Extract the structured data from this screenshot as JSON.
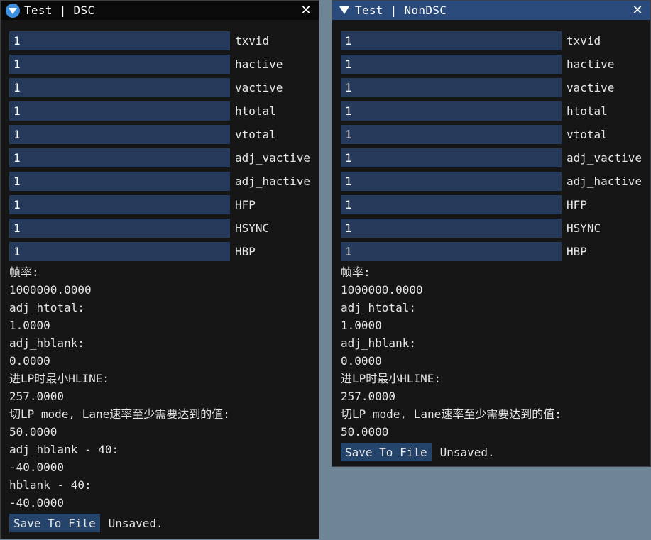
{
  "dsc": {
    "title": "Test | DSC",
    "close": "✕",
    "fields": [
      {
        "value": "1",
        "label": "txvid"
      },
      {
        "value": "1",
        "label": "hactive"
      },
      {
        "value": "1",
        "label": "vactive"
      },
      {
        "value": "1",
        "label": "htotal"
      },
      {
        "value": "1",
        "label": "vtotal"
      },
      {
        "value": "1",
        "label": "adj_vactive"
      },
      {
        "value": "1",
        "label": "adj_hactive"
      },
      {
        "value": "1",
        "label": "HFP"
      },
      {
        "value": "1",
        "label": "HSYNC"
      },
      {
        "value": "1",
        "label": "HBP"
      }
    ],
    "outputs": [
      "帧率:",
      "1000000.0000",
      "adj_htotal:",
      "1.0000",
      "adj_hblank:",
      "0.0000",
      "进LP时最小HLINE:",
      "257.0000",
      "切LP mode, Lane速率至少需要达到的值:",
      "50.0000",
      "adj_hblank - 40:",
      "-40.0000",
      "hblank - 40:",
      "-40.0000"
    ],
    "save_label": "Save To File",
    "status": "Unsaved."
  },
  "nondsc": {
    "title": "Test | NonDSC",
    "close": "✕",
    "fields": [
      {
        "value": "1",
        "label": "txvid"
      },
      {
        "value": "1",
        "label": "hactive"
      },
      {
        "value": "1",
        "label": "vactive"
      },
      {
        "value": "1",
        "label": "htotal"
      },
      {
        "value": "1",
        "label": "vtotal"
      },
      {
        "value": "1",
        "label": "adj_vactive"
      },
      {
        "value": "1",
        "label": "adj_hactive"
      },
      {
        "value": "1",
        "label": "HFP"
      },
      {
        "value": "1",
        "label": "HSYNC"
      },
      {
        "value": "1",
        "label": "HBP"
      }
    ],
    "outputs": [
      "帧率:",
      "1000000.0000",
      "adj_htotal:",
      "1.0000",
      "adj_hblank:",
      "0.0000",
      "进LP时最小HLINE:",
      "257.0000",
      "切LP mode, Lane速率至少需要达到的值:",
      "50.0000"
    ],
    "save_label": "Save To File",
    "status": "Unsaved."
  },
  "colors": {
    "desktop": "#6d8594",
    "window_bg": "#161616",
    "active_titlebar": "#294a7a",
    "input_bg": "#25395a",
    "button_bg": "#25446c"
  }
}
